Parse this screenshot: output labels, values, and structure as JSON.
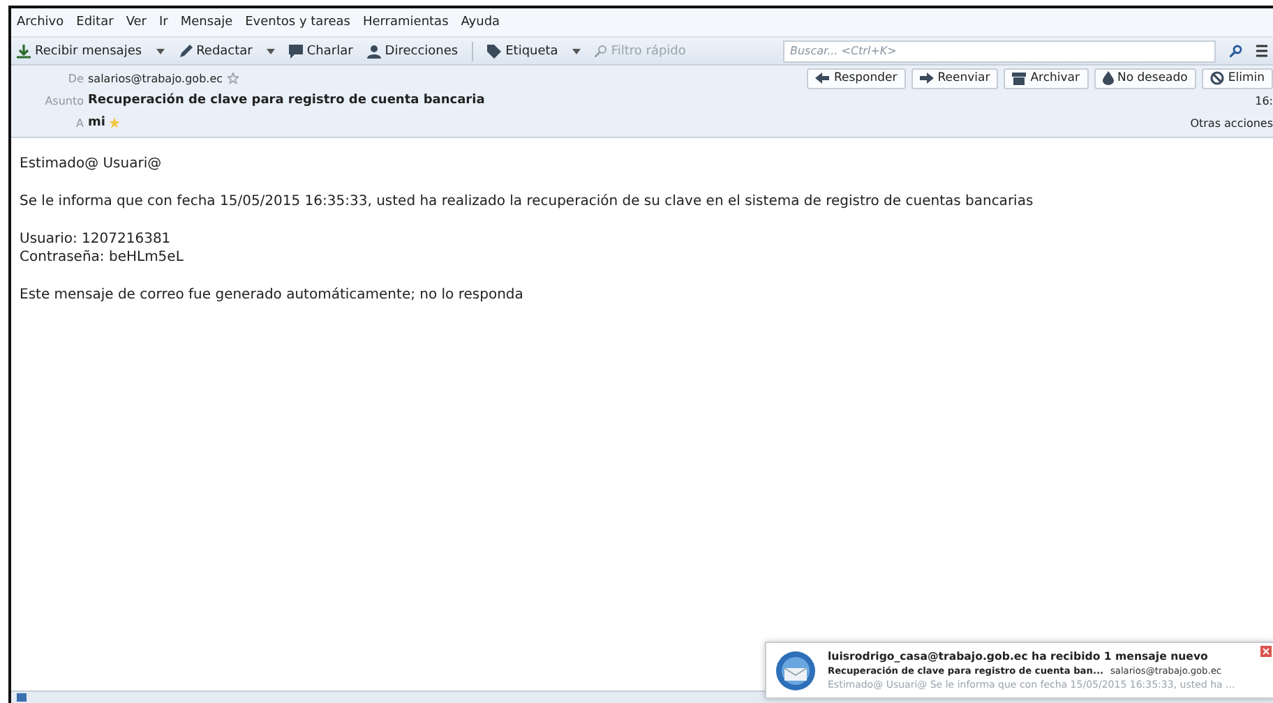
{
  "menu": [
    "Archivo",
    "Editar",
    "Ver",
    "Ir",
    "Mensaje",
    "Eventos y tareas",
    "Herramientas",
    "Ayuda"
  ],
  "toolbar": [
    {
      "kind": "get",
      "label": "Recibir mensajes",
      "dropdown": true
    },
    {
      "kind": "write",
      "label": "Redactar",
      "dropdown": true
    },
    {
      "kind": "chat",
      "label": "Charlar",
      "dropdown": false
    },
    {
      "kind": "contacts",
      "label": "Direcciones",
      "dropdown": false
    },
    {
      "kind": "tag",
      "label": "Etiqueta",
      "dropdown": true
    },
    {
      "kind": "filter",
      "label": "Filtro rápido",
      "dropdown": false
    }
  ],
  "search": {
    "placeholder": "Buscar... <Ctrl+K>"
  },
  "header": {
    "from_label": "De",
    "from": "salarios@trabajo.gob.ec",
    "subject_label": "Asunto",
    "subject": "Recuperación de clave para registro de cuenta bancaria",
    "to_label": "A",
    "to": "mi",
    "time": "16:",
    "other_actions": "Otras acciones"
  },
  "actions": [
    {
      "kind": "reply",
      "label": "Responder"
    },
    {
      "kind": "forward",
      "label": "Reenviar"
    },
    {
      "kind": "archive",
      "label": "Archivar"
    },
    {
      "kind": "junk",
      "label": "No deseado"
    },
    {
      "kind": "delete",
      "label": "Elimin"
    }
  ],
  "body": [
    "Estimado@ Usuari@",
    "Se le informa que con fecha 15/05/2015 16:35:33, usted ha realizado la recuperación de su clave en el sistema de registro de cuentas bancarias",
    "Usuario: 1207216381\nContraseña: beHLm5eL",
    "Este mensaje de correo fue generado automáticamente; no lo responda"
  ],
  "notification": {
    "title": "luisrodrigo_casa@trabajo.gob.ec ha recibido 1 mensaje nuevo",
    "subject": "Recuperación de clave para registro de cuenta ban...",
    "sender": "salarios@trabajo.gob.ec",
    "preview": "Estimado@ Usuari@ Se le informa que con fecha 15/05/2015 16:35:33, usted ha ..."
  }
}
